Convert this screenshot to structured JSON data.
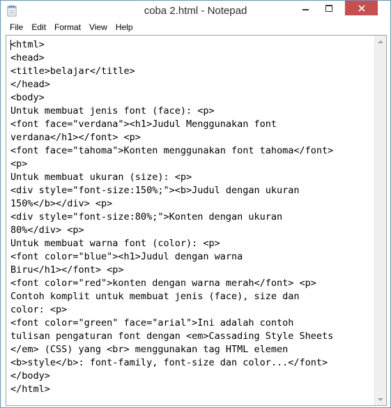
{
  "window": {
    "title": "coba 2.html - Notepad",
    "controls": {
      "minimize_icon": "minimize-icon",
      "maximize_icon": "maximize-icon",
      "close_icon": "close-icon"
    }
  },
  "menu": {
    "items": [
      "File",
      "Edit",
      "Format",
      "View",
      "Help"
    ]
  },
  "editor": {
    "lines": [
      "<html>",
      "<head>",
      "<title>belajar</title>",
      "</head>",
      "<body>",
      "Untuk membuat jenis font (face): <p>",
      "<font face=\"verdana\"><h1>Judul Menggunakan font",
      "verdana</h1></font> <p>",
      "<font face=\"tahoma\">Konten menggunakan font tahoma</font>",
      "<p>",
      "Untuk membuat ukuran (size): <p>",
      "<div style=\"font-size:150%;\"><b>Judul dengan ukuran",
      "150%</b></div> <p>",
      "<div style=\"font-size:80%;\">Konten dengan ukuran",
      "80%</div> <p>",
      "Untuk membuat warna font (color): <p>",
      "<font color=\"blue\"><h1>Judul dengan warna",
      "Biru</h1></font> <p>",
      "<font color=\"red\">konten dengan warna merah</font> <p>",
      "Contoh komplit untuk membuat jenis (face), size dan",
      "color: <p>",
      "<font color=\"green\" face=\"arial\">Ini adalah contoh",
      "tulisan pengaturan font dengan <em>Cassading Style Sheets",
      "</em> (CSS) yang <br> menggunakan tag HTML elemen",
      "<b>style</b>: font-family, font-size dan color...</font>",
      "</body>",
      "</html>"
    ]
  },
  "colors": {
    "close_button": "#c7504f",
    "window_border": "#5b9bd5"
  }
}
